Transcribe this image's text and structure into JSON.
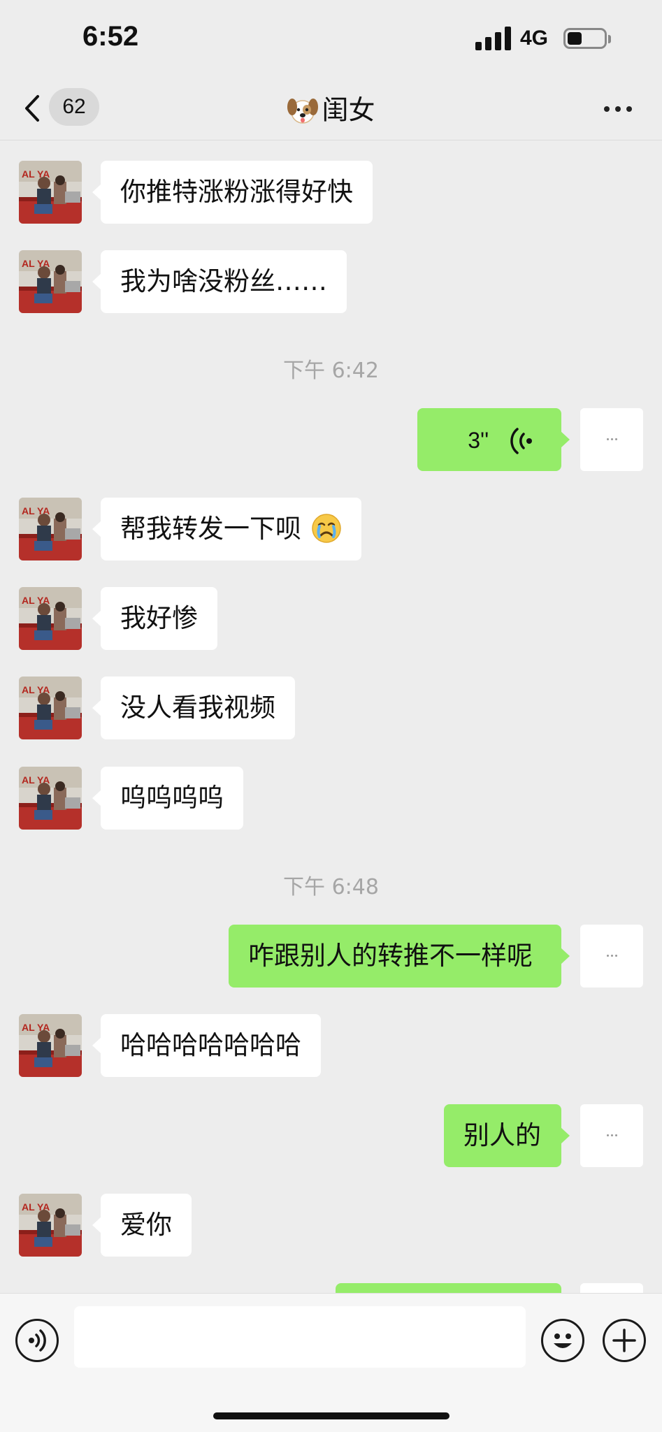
{
  "status_bar": {
    "time": "6:52",
    "network": "4G",
    "battery_level": 0.4
  },
  "nav": {
    "unread_count": "62",
    "title_emoji": "dog-face",
    "title": "闺女"
  },
  "colors": {
    "background": "#ededed",
    "outgoing_bubble": "#95ec69",
    "incoming_bubble": "#ffffff",
    "timestamp": "#a6a6a6"
  },
  "messages": [
    {
      "side": "in",
      "text": "你推特涨粉涨得好快"
    },
    {
      "side": "in",
      "text": "我为啥没粉丝……"
    },
    {
      "type": "time",
      "text": "下午 6:42"
    },
    {
      "side": "out",
      "type": "voice",
      "duration": "3''"
    },
    {
      "side": "in",
      "text": "帮我转发一下呗",
      "emoji": "crying-face"
    },
    {
      "side": "in",
      "text": "我好惨"
    },
    {
      "side": "in",
      "text": "没人看我视频"
    },
    {
      "side": "in",
      "text": "呜呜呜呜"
    },
    {
      "type": "time",
      "text": "下午 6:48"
    },
    {
      "side": "out",
      "text": "咋跟别人的转推不一样呢"
    },
    {
      "side": "in",
      "text": "哈哈哈哈哈哈哈"
    },
    {
      "side": "out",
      "text": "别人的"
    },
    {
      "side": "in",
      "text": "爱你"
    }
  ],
  "input_bar": {
    "voice_icon": "voice-mode-icon",
    "message_value": "",
    "emoji_icon": "emoji-icon",
    "plus_icon": "plus-icon"
  }
}
